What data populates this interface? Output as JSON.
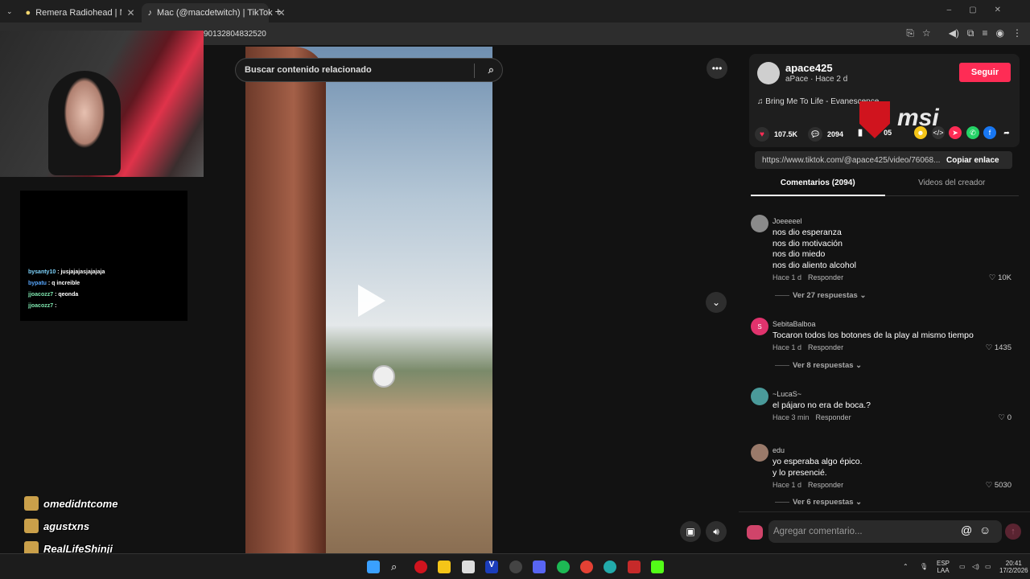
{
  "browser": {
    "tabs": [
      {
        "label": "Remera Radiohead | MercadoLi"
      },
      {
        "label": "Mac (@macdetwitch) | TikTok"
      }
    ],
    "url": "90132804832520"
  },
  "stream": {
    "chat": [
      {
        "user": "bysanty10",
        "msg": ": jusjajajasjajajaja",
        "color": "#7fd6ff"
      },
      {
        "user": "bypatu",
        "msg": ": q increible",
        "color": "#58a8ff"
      },
      {
        "user": "jjoacozz7",
        "msg": ": qeonda",
        "color": "#7fe8b0"
      },
      {
        "user": "jjoacozz7",
        "msg": ":",
        "color": "#7fe8b0"
      }
    ],
    "overlay_names": [
      "omedidntcome",
      "agustxns",
      "RealLifeShinji"
    ]
  },
  "video": {
    "search_placeholder": "Buscar contenido relacionado"
  },
  "post": {
    "username": "apace425",
    "subtitle": "aPace · Hace 2 d",
    "follow_label": "Seguir",
    "music": "Bring Me To Life - Evanescence",
    "likes": "107.5K",
    "comments_count": "2094",
    "saves": "05",
    "link": "https://www.tiktok.com/@apace425/video/76068...",
    "copy_label": "Copiar enlace",
    "watermark": "msi"
  },
  "tabs": {
    "comments": "Comentarios (2094)",
    "creator_videos": "Videos del creador"
  },
  "comments": [
    {
      "name": "Joeeeeel",
      "text": "nos dio esperanza\nnos dio motivación\nnos dio miedo\nnos dio aliento alcohol",
      "time": "Hace 1 d",
      "reply": "Responder",
      "likes": "10K",
      "replies": "Ver 27 respuestas",
      "avatar_color": "#8a8a8a"
    },
    {
      "name": "SebitaBalboa",
      "text": "Tocaron todos los botones de la play al mismo tiempo",
      "time": "Hace 1 d",
      "reply": "Responder",
      "likes": "1435",
      "replies": "Ver 8 respuestas",
      "avatar_color": "#e0336d",
      "initial": "S"
    },
    {
      "name": "~LucaS~",
      "text": "el pájaro no era de boca.?",
      "time": "Hace 3 min",
      "reply": "Responder",
      "likes": "0",
      "avatar_color": "#4a9a9a"
    },
    {
      "name": "edu",
      "text": "yo esperaba algo épico.\ny lo presencié.",
      "time": "Hace 1 d",
      "reply": "Responder",
      "likes": "5030",
      "replies": "Ver 6 respuestas",
      "avatar_color": "#9a7a6a"
    }
  ],
  "add_comment": {
    "placeholder": "Agregar comentario..."
  },
  "taskbar": {
    "lang": "ESP",
    "lang2": "LAA",
    "time": "20:41",
    "date": "17/2/2026"
  }
}
